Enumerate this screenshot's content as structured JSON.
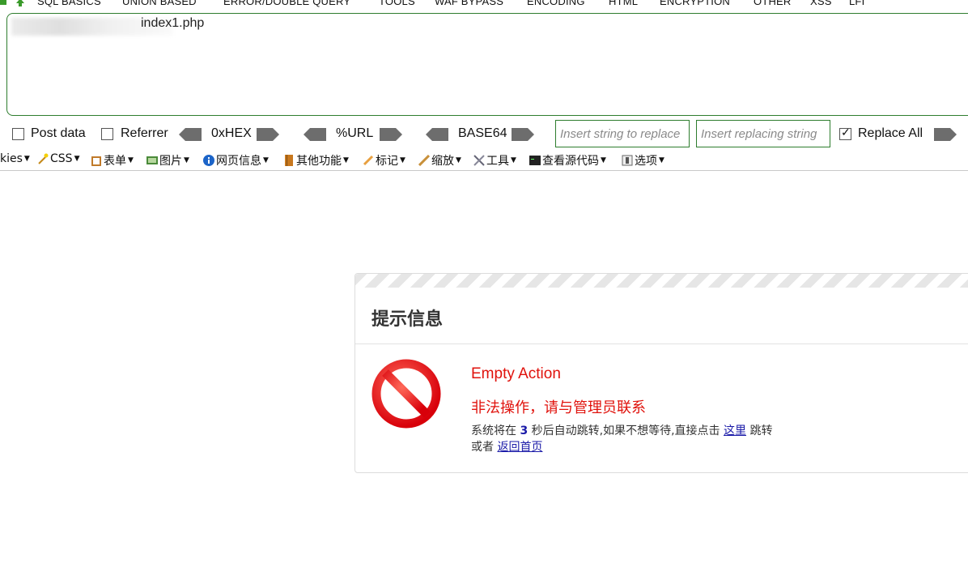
{
  "hackbar": {
    "menu": [
      "SQL BASICS",
      "UNION BASED",
      "ERROR/DOUBLE QUERY",
      "TOOLS",
      "WAF BYPASS",
      "ENCODING",
      "HTML",
      "ENCRYPTION",
      "OTHER",
      "XSS",
      "LFI"
    ],
    "url_value": "index1.php",
    "post_data_label": "Post data",
    "referrer_label": "Referrer",
    "hex_label": "0xHEX",
    "url_label": "%URL",
    "base64_label": "BASE64",
    "replace_placeholder": "Insert string to replace",
    "replacing_placeholder": "Insert replacing string",
    "replace_all_label": "Replace All",
    "post_data_checked": false,
    "referrer_checked": false,
    "replace_all_checked": true
  },
  "devbar": {
    "items": [
      "kies",
      "CSS",
      "表单",
      "图片",
      "网页信息",
      "其他功能",
      "标记",
      "缩放",
      "工具",
      "查看源代码",
      "选项"
    ]
  },
  "message": {
    "title": "提示信息",
    "line1": "Empty Action",
    "line2": "非法操作，请与管理员联系",
    "line3_prefix": "系统将在",
    "seconds": "3",
    "line3_middle": "秒后自动跳转,如果不想等待,直接点击",
    "here_link": "这里",
    "line3_suffix": "跳转",
    "line4_prefix": "或者",
    "home_link": "返回首页",
    "colors": {
      "error": "#e0120c",
      "link": "#1a1aa8",
      "border_green": "#2e7d2e"
    }
  }
}
